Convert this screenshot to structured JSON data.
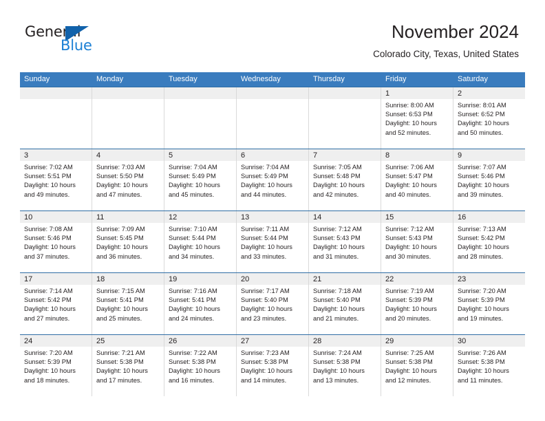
{
  "brand": {
    "name_part1": "General",
    "name_part2": "Blue",
    "logo_icon": "triangle-logo-icon",
    "accent_color": "#1162ab",
    "blue_text_color": "#1a7fd4"
  },
  "header": {
    "title": "November 2024",
    "subtitle": "Colorado City, Texas, United States"
  },
  "theme": {
    "header_row_bg": "#3a7cbe",
    "day_band_bg": "#efefef",
    "week_divider": "#2e6da4",
    "cell_divider": "#d9d9d9",
    "text_color": "#231f20"
  },
  "calendar": {
    "weekday_headers": [
      "Sunday",
      "Monday",
      "Tuesday",
      "Wednesday",
      "Thursday",
      "Friday",
      "Saturday"
    ],
    "labels": {
      "sunrise": "Sunrise:",
      "sunset": "Sunset:",
      "daylight": "Daylight:"
    },
    "weeks": [
      [
        {
          "day": "",
          "empty": true,
          "sunrise": "",
          "sunset": "",
          "daylight_line1": "",
          "daylight_line2": ""
        },
        {
          "day": "",
          "empty": true,
          "sunrise": "",
          "sunset": "",
          "daylight_line1": "",
          "daylight_line2": ""
        },
        {
          "day": "",
          "empty": true,
          "sunrise": "",
          "sunset": "",
          "daylight_line1": "",
          "daylight_line2": ""
        },
        {
          "day": "",
          "empty": true,
          "sunrise": "",
          "sunset": "",
          "daylight_line1": "",
          "daylight_line2": ""
        },
        {
          "day": "",
          "empty": true,
          "sunrise": "",
          "sunset": "",
          "daylight_line1": "",
          "daylight_line2": ""
        },
        {
          "day": "1",
          "empty": false,
          "sunrise": "Sunrise: 8:00 AM",
          "sunset": "Sunset: 6:53 PM",
          "daylight_line1": "Daylight: 10 hours",
          "daylight_line2": "and 52 minutes."
        },
        {
          "day": "2",
          "empty": false,
          "sunrise": "Sunrise: 8:01 AM",
          "sunset": "Sunset: 6:52 PM",
          "daylight_line1": "Daylight: 10 hours",
          "daylight_line2": "and 50 minutes."
        }
      ],
      [
        {
          "day": "3",
          "empty": false,
          "sunrise": "Sunrise: 7:02 AM",
          "sunset": "Sunset: 5:51 PM",
          "daylight_line1": "Daylight: 10 hours",
          "daylight_line2": "and 49 minutes."
        },
        {
          "day": "4",
          "empty": false,
          "sunrise": "Sunrise: 7:03 AM",
          "sunset": "Sunset: 5:50 PM",
          "daylight_line1": "Daylight: 10 hours",
          "daylight_line2": "and 47 minutes."
        },
        {
          "day": "5",
          "empty": false,
          "sunrise": "Sunrise: 7:04 AM",
          "sunset": "Sunset: 5:49 PM",
          "daylight_line1": "Daylight: 10 hours",
          "daylight_line2": "and 45 minutes."
        },
        {
          "day": "6",
          "empty": false,
          "sunrise": "Sunrise: 7:04 AM",
          "sunset": "Sunset: 5:49 PM",
          "daylight_line1": "Daylight: 10 hours",
          "daylight_line2": "and 44 minutes."
        },
        {
          "day": "7",
          "empty": false,
          "sunrise": "Sunrise: 7:05 AM",
          "sunset": "Sunset: 5:48 PM",
          "daylight_line1": "Daylight: 10 hours",
          "daylight_line2": "and 42 minutes."
        },
        {
          "day": "8",
          "empty": false,
          "sunrise": "Sunrise: 7:06 AM",
          "sunset": "Sunset: 5:47 PM",
          "daylight_line1": "Daylight: 10 hours",
          "daylight_line2": "and 40 minutes."
        },
        {
          "day": "9",
          "empty": false,
          "sunrise": "Sunrise: 7:07 AM",
          "sunset": "Sunset: 5:46 PM",
          "daylight_line1": "Daylight: 10 hours",
          "daylight_line2": "and 39 minutes."
        }
      ],
      [
        {
          "day": "10",
          "empty": false,
          "sunrise": "Sunrise: 7:08 AM",
          "sunset": "Sunset: 5:46 PM",
          "daylight_line1": "Daylight: 10 hours",
          "daylight_line2": "and 37 minutes."
        },
        {
          "day": "11",
          "empty": false,
          "sunrise": "Sunrise: 7:09 AM",
          "sunset": "Sunset: 5:45 PM",
          "daylight_line1": "Daylight: 10 hours",
          "daylight_line2": "and 36 minutes."
        },
        {
          "day": "12",
          "empty": false,
          "sunrise": "Sunrise: 7:10 AM",
          "sunset": "Sunset: 5:44 PM",
          "daylight_line1": "Daylight: 10 hours",
          "daylight_line2": "and 34 minutes."
        },
        {
          "day": "13",
          "empty": false,
          "sunrise": "Sunrise: 7:11 AM",
          "sunset": "Sunset: 5:44 PM",
          "daylight_line1": "Daylight: 10 hours",
          "daylight_line2": "and 33 minutes."
        },
        {
          "day": "14",
          "empty": false,
          "sunrise": "Sunrise: 7:12 AM",
          "sunset": "Sunset: 5:43 PM",
          "daylight_line1": "Daylight: 10 hours",
          "daylight_line2": "and 31 minutes."
        },
        {
          "day": "15",
          "empty": false,
          "sunrise": "Sunrise: 7:12 AM",
          "sunset": "Sunset: 5:43 PM",
          "daylight_line1": "Daylight: 10 hours",
          "daylight_line2": "and 30 minutes."
        },
        {
          "day": "16",
          "empty": false,
          "sunrise": "Sunrise: 7:13 AM",
          "sunset": "Sunset: 5:42 PM",
          "daylight_line1": "Daylight: 10 hours",
          "daylight_line2": "and 28 minutes."
        }
      ],
      [
        {
          "day": "17",
          "empty": false,
          "sunrise": "Sunrise: 7:14 AM",
          "sunset": "Sunset: 5:42 PM",
          "daylight_line1": "Daylight: 10 hours",
          "daylight_line2": "and 27 minutes."
        },
        {
          "day": "18",
          "empty": false,
          "sunrise": "Sunrise: 7:15 AM",
          "sunset": "Sunset: 5:41 PM",
          "daylight_line1": "Daylight: 10 hours",
          "daylight_line2": "and 25 minutes."
        },
        {
          "day": "19",
          "empty": false,
          "sunrise": "Sunrise: 7:16 AM",
          "sunset": "Sunset: 5:41 PM",
          "daylight_line1": "Daylight: 10 hours",
          "daylight_line2": "and 24 minutes."
        },
        {
          "day": "20",
          "empty": false,
          "sunrise": "Sunrise: 7:17 AM",
          "sunset": "Sunset: 5:40 PM",
          "daylight_line1": "Daylight: 10 hours",
          "daylight_line2": "and 23 minutes."
        },
        {
          "day": "21",
          "empty": false,
          "sunrise": "Sunrise: 7:18 AM",
          "sunset": "Sunset: 5:40 PM",
          "daylight_line1": "Daylight: 10 hours",
          "daylight_line2": "and 21 minutes."
        },
        {
          "day": "22",
          "empty": false,
          "sunrise": "Sunrise: 7:19 AM",
          "sunset": "Sunset: 5:39 PM",
          "daylight_line1": "Daylight: 10 hours",
          "daylight_line2": "and 20 minutes."
        },
        {
          "day": "23",
          "empty": false,
          "sunrise": "Sunrise: 7:20 AM",
          "sunset": "Sunset: 5:39 PM",
          "daylight_line1": "Daylight: 10 hours",
          "daylight_line2": "and 19 minutes."
        }
      ],
      [
        {
          "day": "24",
          "empty": false,
          "sunrise": "Sunrise: 7:20 AM",
          "sunset": "Sunset: 5:39 PM",
          "daylight_line1": "Daylight: 10 hours",
          "daylight_line2": "and 18 minutes."
        },
        {
          "day": "25",
          "empty": false,
          "sunrise": "Sunrise: 7:21 AM",
          "sunset": "Sunset: 5:38 PM",
          "daylight_line1": "Daylight: 10 hours",
          "daylight_line2": "and 17 minutes."
        },
        {
          "day": "26",
          "empty": false,
          "sunrise": "Sunrise: 7:22 AM",
          "sunset": "Sunset: 5:38 PM",
          "daylight_line1": "Daylight: 10 hours",
          "daylight_line2": "and 16 minutes."
        },
        {
          "day": "27",
          "empty": false,
          "sunrise": "Sunrise: 7:23 AM",
          "sunset": "Sunset: 5:38 PM",
          "daylight_line1": "Daylight: 10 hours",
          "daylight_line2": "and 14 minutes."
        },
        {
          "day": "28",
          "empty": false,
          "sunrise": "Sunrise: 7:24 AM",
          "sunset": "Sunset: 5:38 PM",
          "daylight_line1": "Daylight: 10 hours",
          "daylight_line2": "and 13 minutes."
        },
        {
          "day": "29",
          "empty": false,
          "sunrise": "Sunrise: 7:25 AM",
          "sunset": "Sunset: 5:38 PM",
          "daylight_line1": "Daylight: 10 hours",
          "daylight_line2": "and 12 minutes."
        },
        {
          "day": "30",
          "empty": false,
          "sunrise": "Sunrise: 7:26 AM",
          "sunset": "Sunset: 5:38 PM",
          "daylight_line1": "Daylight: 10 hours",
          "daylight_line2": "and 11 minutes."
        }
      ]
    ]
  }
}
